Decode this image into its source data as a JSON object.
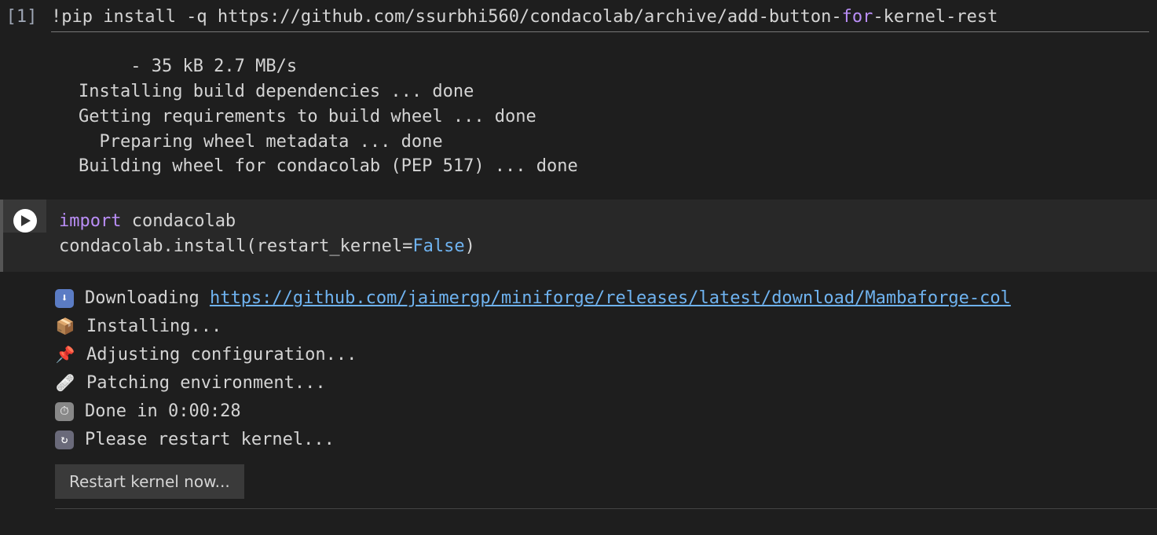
{
  "cell1": {
    "exec_count": "[1]",
    "code": {
      "prefix": "!pip install -q  ",
      "url_pre": "https://github.com/ssurbhi560/condacolab/archive/add-button-",
      "kw": "for",
      "url_post": "-kernel-rest"
    },
    "output": "     - 35 kB 2.7 MB/s \nInstalling build dependencies ... done\nGetting requirements to build wheel ... done\n  Preparing wheel metadata ... done\nBuilding wheel for condacolab (PEP 517) ... done"
  },
  "cell2": {
    "code": {
      "line1": {
        "kw": "import",
        "mod": " condacolab"
      },
      "line2": {
        "pre": "condacolab.install(restart_kernel=",
        "val": "False",
        "post": ")"
      }
    },
    "output": {
      "rows": [
        {
          "icon": "⬇️",
          "label": "Downloading ",
          "link": "https://github.com/jaimergp/miniforge/releases/latest/download/Mambaforge-col"
        },
        {
          "icon": "📦",
          "label": "Installing..."
        },
        {
          "icon": "📌",
          "label": "Adjusting configuration..."
        },
        {
          "icon": "🩹",
          "label": "Patching environment..."
        },
        {
          "icon": "⏱",
          "label": "Done in 0:00:28"
        },
        {
          "icon": "🔄",
          "label": "Please restart kernel..."
        }
      ],
      "button": "Restart kernel now..."
    }
  }
}
